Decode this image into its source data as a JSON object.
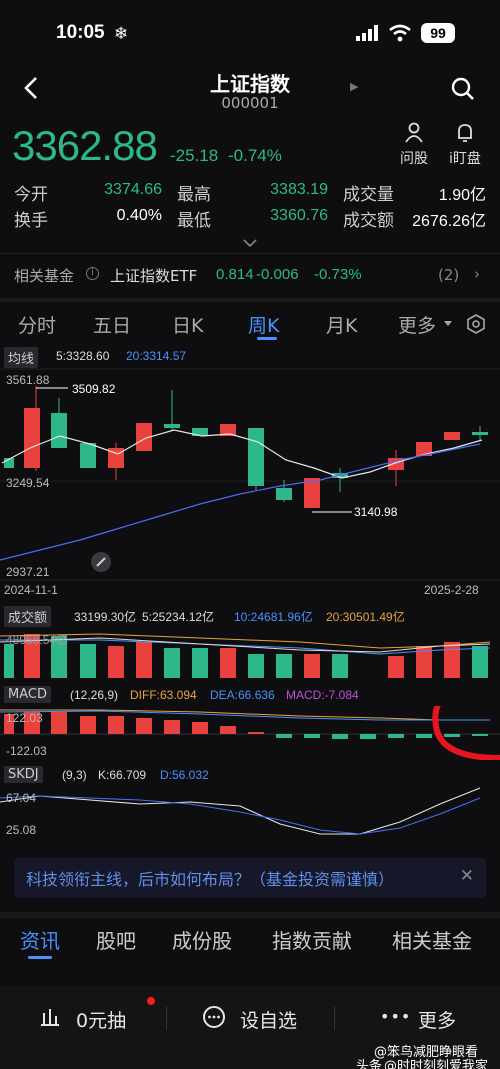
{
  "status": {
    "time": "10:05",
    "battery": "99"
  },
  "header": {
    "title": "上证指数",
    "code": "000001"
  },
  "quote": {
    "price": "3362.88",
    "change": "-25.18",
    "change_pct": "-0.74%"
  },
  "tools": [
    {
      "label": "问股",
      "icon": "person-icon"
    },
    {
      "label": "i盯盘",
      "icon": "bell-icon"
    }
  ],
  "stats": {
    "open_label": "今开",
    "open": "3374.66",
    "high_label": "最高",
    "high": "3383.19",
    "volume_label": "成交量",
    "volume": "1.90亿",
    "turnover_label": "换手",
    "turnover": "0.40%",
    "low_label": "最低",
    "low": "3360.76",
    "amount_label": "成交额",
    "amount": "2676.26亿"
  },
  "fund": {
    "label": "相关基金",
    "name": "上证指数ETF",
    "price": "0.814",
    "change": "-0.006",
    "pct": "-0.73%",
    "count": "(2)"
  },
  "tabs": [
    "分时",
    "五日",
    "日K",
    "周K",
    "月K",
    "更多"
  ],
  "active_tab": "周K",
  "ma": {
    "label": "均线",
    "ma5": "5:3328.60",
    "ma20": "20:3314.57"
  },
  "kline": {
    "ymax": "3561.88",
    "ymin": "2937.21",
    "mid": "3249.54",
    "high_mark": "3509.82",
    "low_mark": "3140.98",
    "date_start": "2024-11-1",
    "date_end": "2025-2-28"
  },
  "volume": {
    "label": "成交额",
    "v": "33199.30亿",
    "ma5": "5:25234.12亿",
    "ma10": "10:24681.96亿",
    "ma20": "20:30501.49亿",
    "top": "48958.54亿"
  },
  "macd": {
    "label": "MACD",
    "params": "(12,26,9)",
    "diff": "DIFF:63.094",
    "dea": "DEA:66.636",
    "macd": "MACD:-7.084",
    "top": "122.03",
    "bottom": "-122.03"
  },
  "skdj": {
    "label": "SKDJ",
    "params": "(9,3)",
    "k": "K:66.709",
    "d": "D:56.032",
    "top": "67.04",
    "bottom": "25.08"
  },
  "banner": {
    "text": "科技领衔主线，后市如何布局？（基金投资需谨慎）"
  },
  "news_tabs": [
    "资讯",
    "股吧",
    "成份股",
    "指数贡献",
    "相关基金"
  ],
  "bottom_bar": {
    "lottery": "0元抽",
    "add": "设自选",
    "more": "更多"
  },
  "watermark": {
    "line1": "@笨鸟减肥睁眼看",
    "line2": "@时时刻刻爱我家",
    "prefix": "头条"
  },
  "colors": {
    "up": "#e8413e",
    "down": "#2eb88a",
    "accent": "#4a90ff"
  }
}
